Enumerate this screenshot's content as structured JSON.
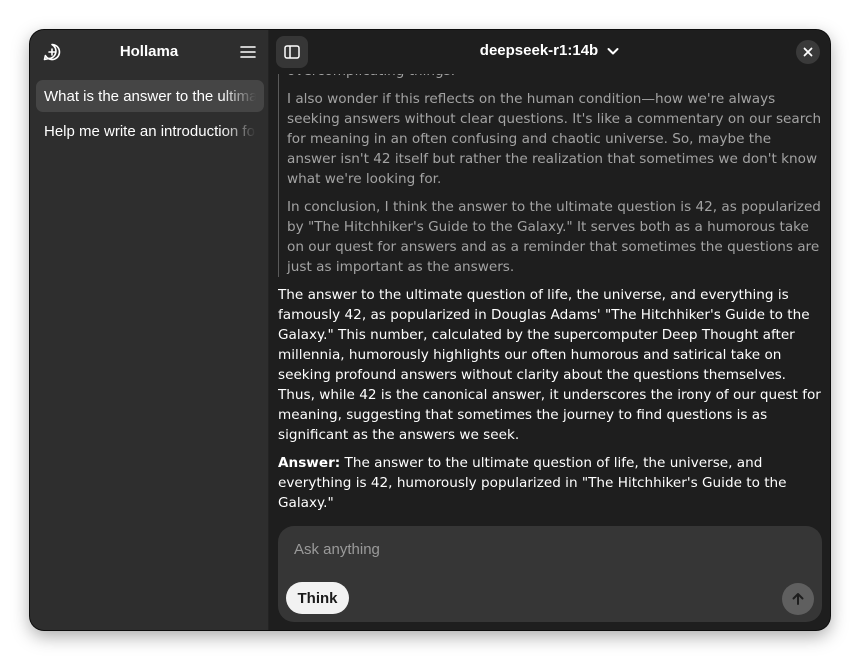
{
  "sidebar": {
    "title": "Hollama",
    "new_chat_icon": "new-chat-icon",
    "menu_icon": "menu-icon",
    "conversations": [
      {
        "label": "What is the answer to the ultimate question of life, the universe, and everything?"
      },
      {
        "label": "Help me write an introduction for my essay"
      }
    ]
  },
  "header": {
    "toggle_icon": "sidebar-toggle-icon",
    "model": "deepseek-r1:14b",
    "model_chevron_icon": "chevron-down-icon",
    "close_icon": "close-icon"
  },
  "thinking": {
    "fragment": "overcomplicating things.",
    "paragraphs": [
      "I also wonder if this reflects on the human condition—how we're always seeking answers without clear questions. It's like a commentary on our search for meaning in an often confusing and chaotic universe. So, maybe the answer isn't 42 itself but rather the realization that sometimes we don't know what we're looking for.",
      "In conclusion, I think the answer to the ultimate question is 42, as popularized by \"The Hitchhiker's Guide to the Galaxy.\" It serves both as a humorous take on our quest for answers and as a reminder that sometimes the questions are just as important as the answers."
    ]
  },
  "answer": {
    "paragraph": "The answer to the ultimate question of life, the universe, and everything is famously 42, as popularized in Douglas Adams' \"The Hitchhiker's Guide to the Galaxy.\" This number, calculated by the supercomputer Deep Thought after millennia, humorously highlights our often humorous and satirical take on seeking profound answers without clarity about the questions themselves. Thus, while 42 is the canonical answer, it underscores the irony of our quest for meaning, suggesting that sometimes the journey to find questions is as significant as the answers we seek.",
    "final_label": "Answer:",
    "final_text": " The answer to the ultimate question of life, the universe, and everything is 42, humorously popularized in \"The Hitchhiker's Guide to the Galaxy.\""
  },
  "composer": {
    "placeholder": "Ask anything",
    "value": "",
    "think_label": "Think",
    "send_icon": "arrow-up-icon"
  }
}
